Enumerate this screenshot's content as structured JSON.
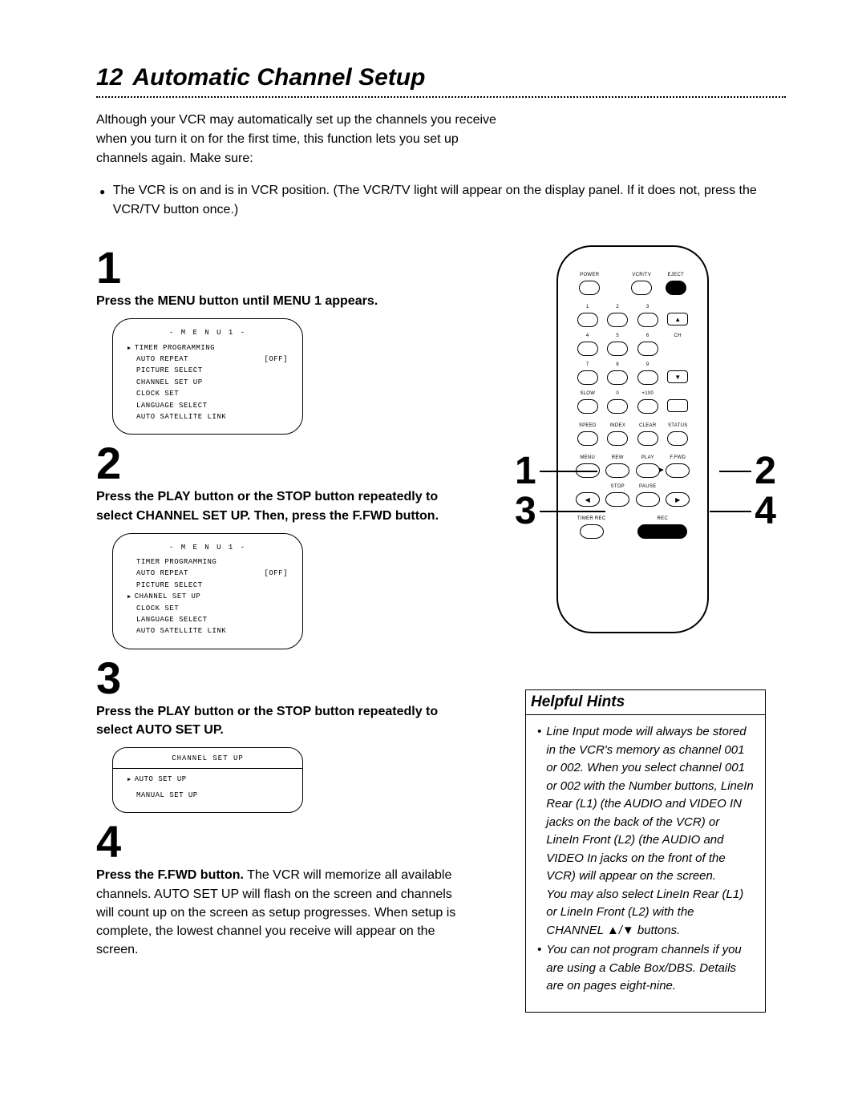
{
  "page": {
    "number": "12",
    "title": "Automatic Channel Setup"
  },
  "intro": "Although your VCR may automatically set up the channels you receive when you turn it on for the first time, this function lets you set up channels again. Make sure:",
  "intro_bullet": "The VCR is on and is in VCR position. (The VCR/TV light will appear on the display panel. If it does not, press the VCR/TV button once.)",
  "steps": {
    "s1": {
      "n": "1",
      "head": "Press the MENU button until MENU 1 appears."
    },
    "s2": {
      "n": "2",
      "head": "Press the PLAY button or the STOP button repeatedly to select CHANNEL SET UP.  Then, press the F.FWD button."
    },
    "s3": {
      "n": "3",
      "head": "Press the PLAY button or the STOP button repeatedly to select AUTO SET UP."
    },
    "s4": {
      "n": "4",
      "lead": "Press the F.FWD button.",
      "body": " The VCR will memorize all available channels.  AUTO SET UP will flash on the screen and channels will count up on the screen as setup progresses. When setup is complete, the lowest channel you receive will appear on the screen."
    }
  },
  "osd1": {
    "title": "- M E N U 1 -",
    "lines": [
      {
        "ptr": true,
        "l": "TIMER PROGRAMMING",
        "r": ""
      },
      {
        "ptr": false,
        "l": "AUTO REPEAT",
        "r": "[OFF]"
      },
      {
        "ptr": false,
        "l": "PICTURE SELECT",
        "r": ""
      },
      {
        "ptr": false,
        "l": "CHANNEL SET UP",
        "r": ""
      },
      {
        "ptr": false,
        "l": "CLOCK SET",
        "r": ""
      },
      {
        "ptr": false,
        "l": "LANGUAGE SELECT",
        "r": ""
      },
      {
        "ptr": false,
        "l": "AUTO SATELLITE LINK",
        "r": ""
      }
    ]
  },
  "osd2": {
    "title": "- M E N U 1 -",
    "lines": [
      {
        "ptr": false,
        "l": "TIMER PROGRAMMING",
        "r": ""
      },
      {
        "ptr": false,
        "l": "AUTO REPEAT",
        "r": "[OFF]"
      },
      {
        "ptr": false,
        "l": "PICTURE SELECT",
        "r": ""
      },
      {
        "ptr": true,
        "l": "CHANNEL SET UP",
        "r": ""
      },
      {
        "ptr": false,
        "l": "CLOCK SET",
        "r": ""
      },
      {
        "ptr": false,
        "l": "LANGUAGE SELECT",
        "r": ""
      },
      {
        "ptr": false,
        "l": "AUTO SATELLITE LINK",
        "r": ""
      }
    ]
  },
  "osd3": {
    "title": "CHANNEL SET UP",
    "lines": [
      {
        "ptr": true,
        "l": "AUTO SET UP",
        "r": ""
      },
      {
        "ptr": false,
        "l": "MANUAL SET UP",
        "r": ""
      }
    ]
  },
  "callouts": {
    "c1": "1",
    "c2": "2",
    "c3": "3",
    "c4": "4"
  },
  "hints": {
    "title": "Helpful Hints",
    "items": [
      "Line Input mode will always be stored in the VCR's memory as channel 001 or 002. When you select channel 001 or 002 with the Number buttons, LineIn Rear (L1) (the AUDIO and VIDEO IN jacks on the back of the VCR) or LineIn Front (L2) (the AUDIO and VIDEO In jacks on the front of the VCR) will appear on the screen.\nYou may also select LineIn Rear (L1) or LineIn Front (L2) with the CHANNEL ▲/▼ buttons.",
      "You can not program channels if you are using a Cable Box/DBS. Details are on pages eight-nine."
    ]
  },
  "remote_labels": {
    "r1": [
      "",
      "",
      ""
    ],
    "nums": [
      "1",
      "2",
      "3",
      "4",
      "5",
      "6",
      "7",
      "8",
      "9",
      "0",
      "+100"
    ],
    "transport": [
      "REW",
      "PLAY",
      "F.FWD",
      "STOP",
      "PAUSE",
      "REC"
    ]
  }
}
